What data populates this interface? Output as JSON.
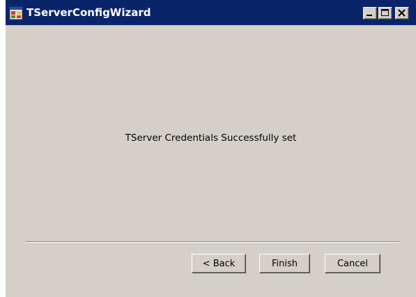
{
  "window": {
    "title": "TServerConfigWizard"
  },
  "caption_buttons": {
    "minimize": "minimize-icon",
    "maximize": "maximize-icon",
    "close": "close-icon"
  },
  "content": {
    "message": "TServer Credentials Successfully set"
  },
  "buttons": {
    "back_label": "< Back",
    "finish_label": "Finish",
    "cancel_label": "Cancel"
  },
  "colors": {
    "titlebar": "#0a246a",
    "face": "#d4d0c8"
  }
}
